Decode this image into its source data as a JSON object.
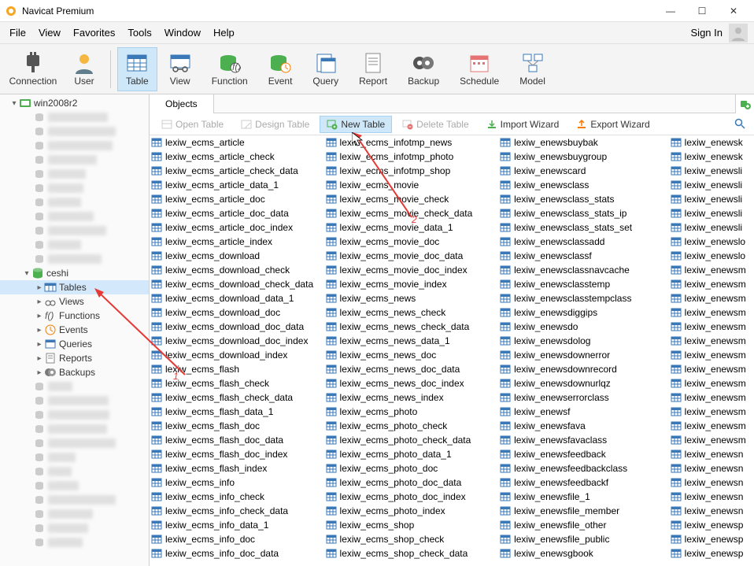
{
  "app": {
    "title": "Navicat Premium"
  },
  "window": {
    "minimize": "—",
    "maximize": "☐",
    "close": "✕"
  },
  "menu": [
    "File",
    "View",
    "Favorites",
    "Tools",
    "Window",
    "Help"
  ],
  "signin": {
    "label": "Sign In"
  },
  "ribbon": {
    "items": [
      {
        "label": "Connection",
        "icon": "plug"
      },
      {
        "label": "User",
        "icon": "user"
      },
      {
        "label": "Table",
        "icon": "table",
        "active": true
      },
      {
        "label": "View",
        "icon": "view"
      },
      {
        "label": "Function",
        "icon": "fx"
      },
      {
        "label": "Event",
        "icon": "event"
      },
      {
        "label": "Query",
        "icon": "query"
      },
      {
        "label": "Report",
        "icon": "report"
      },
      {
        "label": "Backup",
        "icon": "backup"
      },
      {
        "label": "Schedule",
        "icon": "schedule"
      },
      {
        "label": "Model",
        "icon": "model"
      }
    ]
  },
  "tree": {
    "root": {
      "label": "win2008r2",
      "icon": "server-green"
    },
    "db": {
      "label": "ceshi",
      "icon": "db-green"
    },
    "nodes": [
      {
        "label": "Tables",
        "icon": "tables",
        "selected": true
      },
      {
        "label": "Views",
        "icon": "views"
      },
      {
        "label": "Functions",
        "icon": "functions"
      },
      {
        "label": "Events",
        "icon": "events"
      },
      {
        "label": "Queries",
        "icon": "queries"
      },
      {
        "label": "Reports",
        "icon": "reports"
      },
      {
        "label": "Backups",
        "icon": "backups"
      }
    ],
    "blurred_count_top": 11,
    "blurred_count_bottom": 12
  },
  "tabs": {
    "objects": "Objects"
  },
  "toolbar": {
    "open_table": "Open Table",
    "design_table": "Design Table",
    "new_table": "New Table",
    "delete_table": "Delete Table",
    "import_wizard": "Import Wizard",
    "export_wizard": "Export Wizard"
  },
  "annotations": {
    "num1": "1",
    "num2": "2"
  },
  "tables": {
    "col0": [
      "lexiw_ecms_article",
      "lexiw_ecms_article_check",
      "lexiw_ecms_article_check_data",
      "lexiw_ecms_article_data_1",
      "lexiw_ecms_article_doc",
      "lexiw_ecms_article_doc_data",
      "lexiw_ecms_article_doc_index",
      "lexiw_ecms_article_index",
      "lexiw_ecms_download",
      "lexiw_ecms_download_check",
      "lexiw_ecms_download_check_data",
      "lexiw_ecms_download_data_1",
      "lexiw_ecms_download_doc",
      "lexiw_ecms_download_doc_data",
      "lexiw_ecms_download_doc_index",
      "lexiw_ecms_download_index",
      "lexiw_ecms_flash",
      "lexiw_ecms_flash_check",
      "lexiw_ecms_flash_check_data",
      "lexiw_ecms_flash_data_1",
      "lexiw_ecms_flash_doc",
      "lexiw_ecms_flash_doc_data",
      "lexiw_ecms_flash_doc_index",
      "lexiw_ecms_flash_index",
      "lexiw_ecms_info",
      "lexiw_ecms_info_check",
      "lexiw_ecms_info_check_data",
      "lexiw_ecms_info_data_1",
      "lexiw_ecms_info_doc",
      "lexiw_ecms_info_doc_data"
    ],
    "col1": [
      "lexiw_ecms_infotmp_news",
      "lexiw_ecms_infotmp_photo",
      "lexiw_ecms_infotmp_shop",
      "lexiw_ecms_movie",
      "lexiw_ecms_movie_check",
      "lexiw_ecms_movie_check_data",
      "lexiw_ecms_movie_data_1",
      "lexiw_ecms_movie_doc",
      "lexiw_ecms_movie_doc_data",
      "lexiw_ecms_movie_doc_index",
      "lexiw_ecms_movie_index",
      "lexiw_ecms_news",
      "lexiw_ecms_news_check",
      "lexiw_ecms_news_check_data",
      "lexiw_ecms_news_data_1",
      "lexiw_ecms_news_doc",
      "lexiw_ecms_news_doc_data",
      "lexiw_ecms_news_doc_index",
      "lexiw_ecms_news_index",
      "lexiw_ecms_photo",
      "lexiw_ecms_photo_check",
      "lexiw_ecms_photo_check_data",
      "lexiw_ecms_photo_data_1",
      "lexiw_ecms_photo_doc",
      "lexiw_ecms_photo_doc_data",
      "lexiw_ecms_photo_doc_index",
      "lexiw_ecms_photo_index",
      "lexiw_ecms_shop",
      "lexiw_ecms_shop_check",
      "lexiw_ecms_shop_check_data"
    ],
    "col2": [
      "lexiw_enewsbuybak",
      "lexiw_enewsbuygroup",
      "lexiw_enewscard",
      "lexiw_enewsclass",
      "lexiw_enewsclass_stats",
      "lexiw_enewsclass_stats_ip",
      "lexiw_enewsclass_stats_set",
      "lexiw_enewsclassadd",
      "lexiw_enewsclassf",
      "lexiw_enewsclassnavcache",
      "lexiw_enewsclasstemp",
      "lexiw_enewsclasstempclass",
      "lexiw_enewsdiggips",
      "lexiw_enewsdo",
      "lexiw_enewsdolog",
      "lexiw_enewsdownerror",
      "lexiw_enewsdownrecord",
      "lexiw_enewsdownurlqz",
      "lexiw_enewserrorclass",
      "lexiw_enewsf",
      "lexiw_enewsfava",
      "lexiw_enewsfavaclass",
      "lexiw_enewsfeedback",
      "lexiw_enewsfeedbackclass",
      "lexiw_enewsfeedbackf",
      "lexiw_enewsfile_1",
      "lexiw_enewsfile_member",
      "lexiw_enewsfile_other",
      "lexiw_enewsfile_public",
      "lexiw_enewsgbook"
    ],
    "col3": [
      "lexiw_enewsk",
      "lexiw_enewsk",
      "lexiw_enewsli",
      "lexiw_enewsli",
      "lexiw_enewsli",
      "lexiw_enewsli",
      "lexiw_enewsli",
      "lexiw_enewslo",
      "lexiw_enewslo",
      "lexiw_enewsm",
      "lexiw_enewsm",
      "lexiw_enewsm",
      "lexiw_enewsm",
      "lexiw_enewsm",
      "lexiw_enewsm",
      "lexiw_enewsm",
      "lexiw_enewsm",
      "lexiw_enewsm",
      "lexiw_enewsm",
      "lexiw_enewsm",
      "lexiw_enewsm",
      "lexiw_enewsm",
      "lexiw_enewsn",
      "lexiw_enewsn",
      "lexiw_enewsn",
      "lexiw_enewsn",
      "lexiw_enewsn",
      "lexiw_enewsp",
      "lexiw_enewsp",
      "lexiw_enewsp"
    ]
  }
}
